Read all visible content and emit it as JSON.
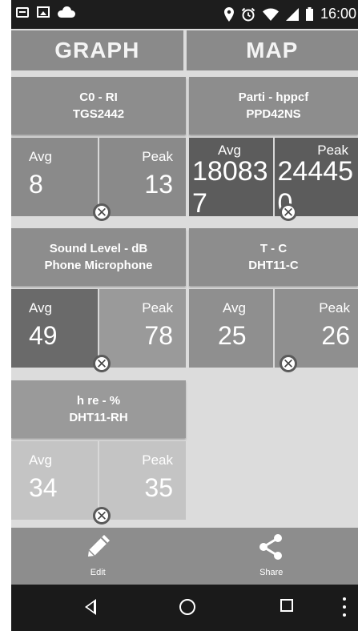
{
  "status_bar": {
    "time": "16:00",
    "icons_left": [
      "message-icon",
      "image-icon",
      "cloud-upload-icon"
    ],
    "icons_right": [
      "location-icon",
      "alarm-icon",
      "wifi-icon",
      "signal-icon",
      "battery-icon"
    ]
  },
  "tabs": [
    {
      "label": "GRAPH"
    },
    {
      "label": "MAP"
    }
  ],
  "tiles": [
    {
      "title": "C0 - RI",
      "sensor": "TGS2442",
      "avg_label": "Avg",
      "avg": "8",
      "peak_label": "Peak",
      "peak": "13"
    },
    {
      "title": "Parti - hppcf",
      "sensor": "PPD42NS",
      "avg_label": "Avg",
      "avg": "180837",
      "peak_label": "Peak",
      "peak": "244450"
    },
    {
      "title": "Sound Level - dB",
      "sensor": "Phone Microphone",
      "avg_label": "Avg",
      "avg": "49",
      "peak_label": "Peak",
      "peak": "78"
    },
    {
      "title": "T - C",
      "sensor": "DHT11-C",
      "avg_label": "Avg",
      "avg": "25",
      "peak_label": "Peak",
      "peak": "26"
    },
    {
      "title": "h re - %",
      "sensor": "DHT11-RH",
      "avg_label": "Avg",
      "avg": "34",
      "peak_label": "Peak",
      "peak": "35"
    }
  ],
  "close_symbol": "✕",
  "actions": [
    {
      "label": "Edit",
      "icon": "pencil-icon"
    },
    {
      "label": "Share",
      "icon": "share-icon"
    }
  ],
  "nav": [
    "back-icon",
    "home-icon",
    "recents-icon",
    "overflow-menu-icon"
  ]
}
